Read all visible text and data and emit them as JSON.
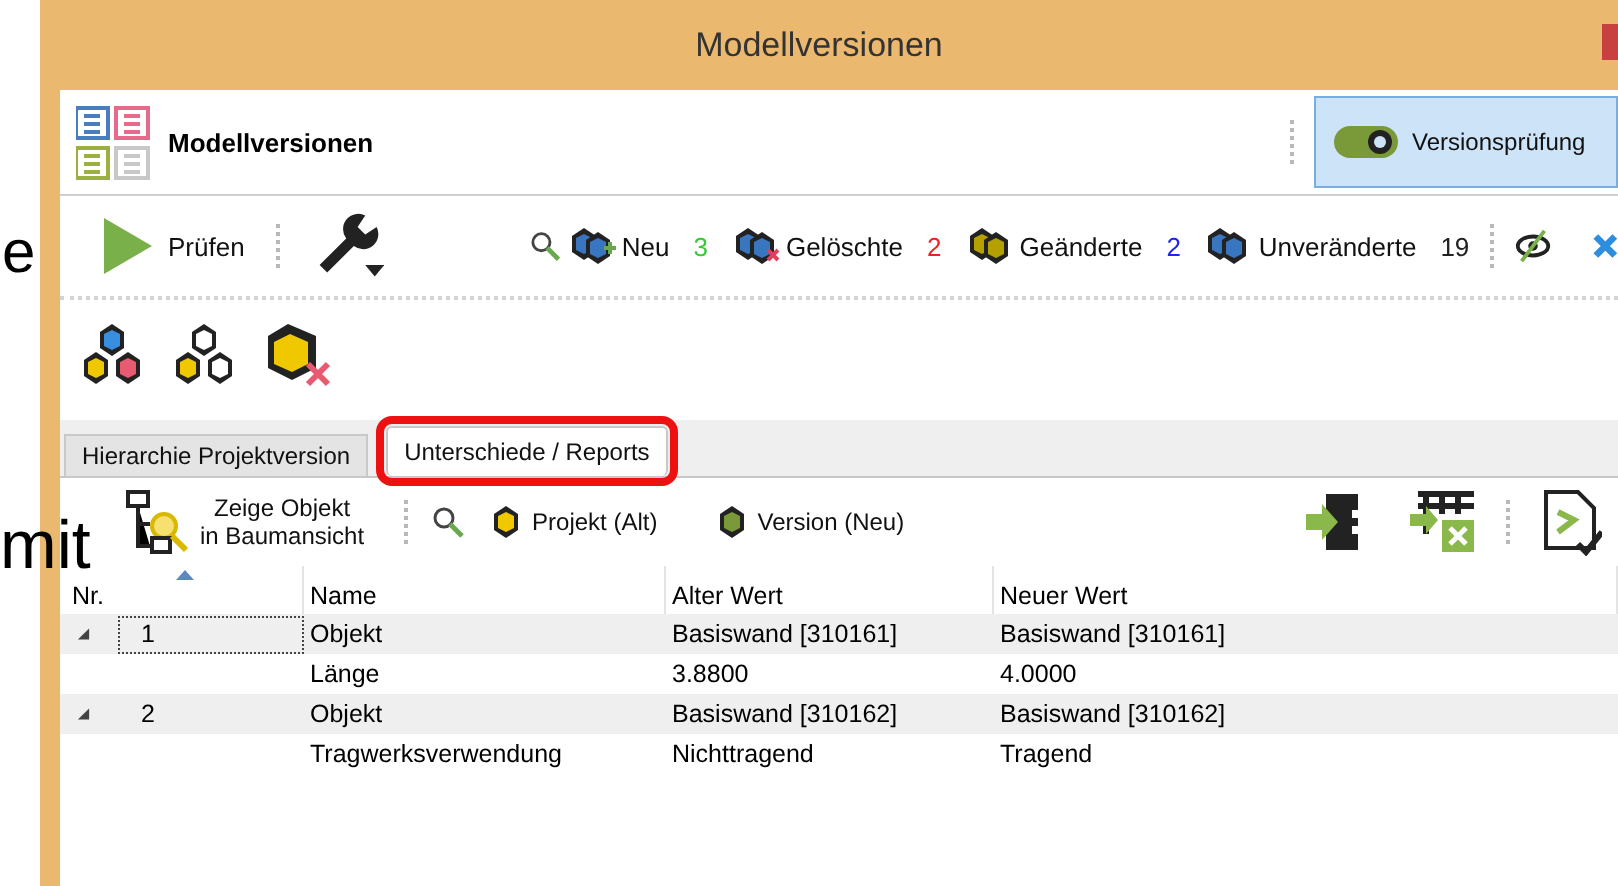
{
  "slide_fragments": [
    "e",
    "mit"
  ],
  "window": {
    "title": "Modellversionen"
  },
  "header": {
    "title": "Modellversionen",
    "toggle": {
      "label": "Versionsprüfung",
      "on": true
    }
  },
  "toolbar": {
    "run_label": "Prüfen",
    "filters": [
      {
        "label": "Neu",
        "count": "3",
        "color": "#33cc33"
      },
      {
        "label": "Gelöschte",
        "count": "2",
        "color": "#ee2222"
      },
      {
        "label": "Geänderte",
        "count": "2",
        "color": "#2222ee"
      },
      {
        "label": "Unveränderte",
        "count": "19",
        "color": "#222222"
      }
    ]
  },
  "tabs": [
    {
      "label": "Hierarchie Projektversion",
      "selected": false,
      "highlighted": false
    },
    {
      "label": "Unterschiede / Reports",
      "selected": true,
      "highlighted": true
    }
  ],
  "subtoolbar": {
    "show_in_tree": "Zeige Objekt\nin Baumansicht",
    "old_project": "Projekt (Alt)",
    "new_version": "Version (Neu)"
  },
  "table": {
    "columns": [
      "Nr.",
      "Name",
      "Alter Wert",
      "Neuer Wert"
    ],
    "rows": [
      {
        "nr": "1",
        "expanded": true,
        "focused": true,
        "name": "Objekt",
        "old": "Basiswand [310161]",
        "new": "Basiswand [310161]",
        "children": [
          {
            "name": "Länge",
            "old": "3.8800",
            "new": "4.0000"
          }
        ]
      },
      {
        "nr": "2",
        "expanded": true,
        "focused": false,
        "name": "Objekt",
        "old": "Basiswand [310162]",
        "new": "Basiswand [310162]",
        "children": [
          {
            "name": "Tragwerksverwendung",
            "old": "Nichttragend",
            "new": "Tragend"
          }
        ]
      }
    ]
  }
}
